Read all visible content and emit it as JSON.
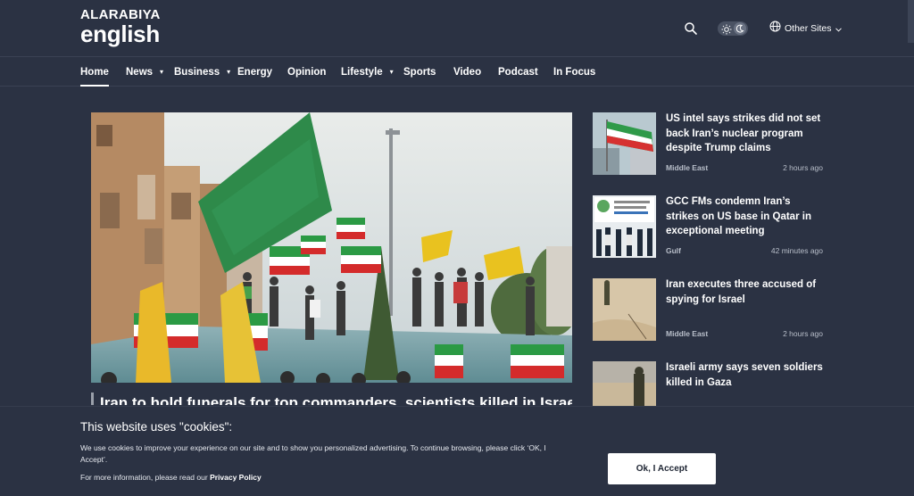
{
  "brand": {
    "top": "ALARABIYA",
    "main": "english"
  },
  "header": {
    "other_sites_label": "Other Sites"
  },
  "icons": {
    "search": "search-icon",
    "sun": "sun-icon",
    "moon": "moon-icon",
    "globe": "globe-icon",
    "chevron": "chevron-down-icon"
  },
  "nav": {
    "items": [
      {
        "label": "Home",
        "active": true
      },
      {
        "label": "News",
        "dropdown": true
      },
      {
        "label": "Business",
        "dropdown": true
      },
      {
        "label": "Energy"
      },
      {
        "label": "Opinion"
      },
      {
        "label": "Lifestyle",
        "dropdown": true
      },
      {
        "label": "Sports"
      },
      {
        "label": "Video"
      },
      {
        "label": "Podcast"
      },
      {
        "label": "In Focus"
      }
    ]
  },
  "hero": {
    "headline": "Iran to hold funerals for top commanders, scientists killed in Israel"
  },
  "side_news": [
    {
      "title": "US intel says strikes did not set back Iran’s nuclear program despite Trump claims",
      "category": "Middle East",
      "time": "2 hours ago"
    },
    {
      "title": "GCC FMs condemn Iran’s strikes on US base in Qatar in exceptional meeting",
      "category": "Gulf",
      "time": "42 minutes ago"
    },
    {
      "title": "Iran executes three accused of spying for Israel",
      "category": "Middle East",
      "time": "2 hours ago"
    },
    {
      "title": "Israeli army says seven soldiers killed in Gaza",
      "category": "",
      "time": ""
    }
  ],
  "cookie": {
    "title": "This website uses \"cookies\":",
    "text": "We use cookies to improve your experience on our site and to show you personalized advertising. To continue browsing, please click ‘OK, I Accept’.",
    "more_prefix": "For more information, please read our",
    "policy_link": "Privacy Policy",
    "accept_label": "Ok, I Accept"
  },
  "colors": {
    "background": "#2b3243",
    "text": "#ffffff",
    "muted": "#b9bfca",
    "button_bg": "#ffffff"
  }
}
